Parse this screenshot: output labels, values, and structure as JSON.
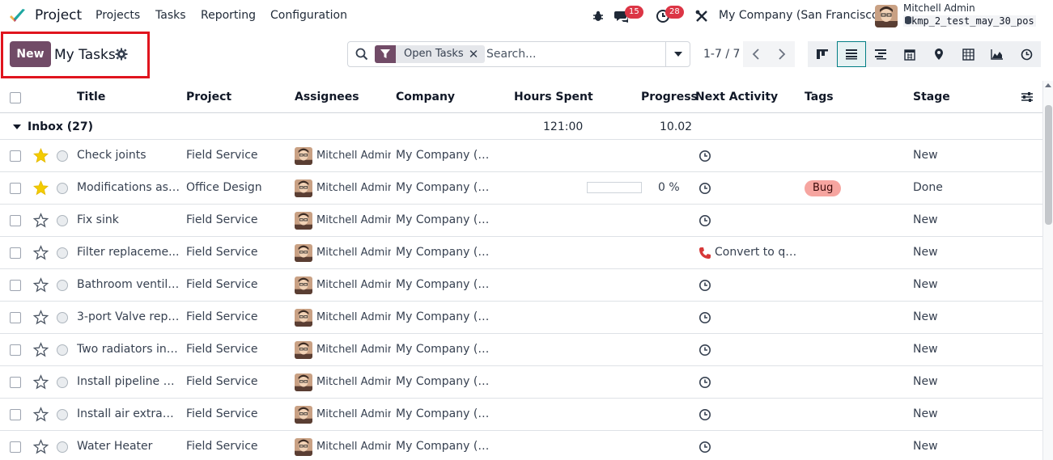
{
  "app": {
    "name": "Project",
    "accent_color": "#714b67"
  },
  "menu": [
    "Projects",
    "Tasks",
    "Reporting",
    "Configuration"
  ],
  "systray": {
    "messages_count": "15",
    "activities_count": "28",
    "company": "My Company (San Francisco)",
    "user_name": "Mitchell Admin",
    "database": "kmp_2_test_may_30_pos"
  },
  "control_panel": {
    "new_label": "New",
    "title": "My Tasks",
    "facet_label": "Open Tasks",
    "search_placeholder": "Search...",
    "pager": "1-7 / 7",
    "views": [
      "kanban",
      "list",
      "gantt",
      "calendar",
      "map",
      "pivot",
      "graph",
      "activity"
    ],
    "active_view": "list"
  },
  "columns": {
    "title": "Title",
    "project": "Project",
    "assignees": "Assignees",
    "company": "Company",
    "hours_spent": "Hours Spent",
    "progress": "Progress",
    "next_activity": "Next Activity",
    "tags": "Tags",
    "stage": "Stage"
  },
  "group": {
    "label": "Inbox (27)",
    "hours": "121:00",
    "progress": "10.02"
  },
  "rows": [
    {
      "title": "Check joints",
      "project": "Field Service",
      "assignee": "Mitchell Admin",
      "company": "My Company (Sa...",
      "starred": true,
      "activity": "",
      "stage": "New"
    },
    {
      "title": "Modifications ask...",
      "project": "Office Design",
      "assignee": "Mitchell Admin",
      "company": "My Company (Sa...",
      "starred": true,
      "activity": "",
      "progress": "0 %",
      "progress_value": 0,
      "tag": "Bug",
      "stage": "Done"
    },
    {
      "title": "Fix sink",
      "project": "Field Service",
      "assignee": "Mitchell Admin",
      "company": "My Company (Sa...",
      "starred": false,
      "activity": "",
      "stage": "New"
    },
    {
      "title": "Filter replaceme...",
      "project": "Field Service",
      "assignee": "Mitchell Admin",
      "company": "My Company (Sa...",
      "starred": false,
      "activity": "Convert to qu...",
      "stage": "New"
    },
    {
      "title": "Bathroom ventila...",
      "project": "Field Service",
      "assignee": "Mitchell Admin",
      "company": "My Company (Sa...",
      "starred": false,
      "activity": "",
      "stage": "New"
    },
    {
      "title": "3-port Valve repl...",
      "project": "Field Service",
      "assignee": "Mitchell Admin",
      "company": "My Company (Sa...",
      "starred": false,
      "activity": "",
      "stage": "New"
    },
    {
      "title": "Two radiators ins...",
      "project": "Field Service",
      "assignee": "Mitchell Admin",
      "company": "My Company (Sa...",
      "starred": false,
      "activity": "",
      "stage": "New"
    },
    {
      "title": "Install pipeline sy...",
      "project": "Field Service",
      "assignee": "Mitchell Admin",
      "company": "My Company (Sa...",
      "starred": false,
      "activity": "",
      "stage": "New"
    },
    {
      "title": "Install air extract...",
      "project": "Field Service",
      "assignee": "Mitchell Admin",
      "company": "My Company (Sa...",
      "starred": false,
      "activity": "",
      "stage": "New"
    },
    {
      "title": "Water Heater",
      "project": "Field Service",
      "assignee": "Mitchell Admin",
      "company": "My Company (Sa...",
      "starred": false,
      "activity": "",
      "stage": "New"
    }
  ]
}
